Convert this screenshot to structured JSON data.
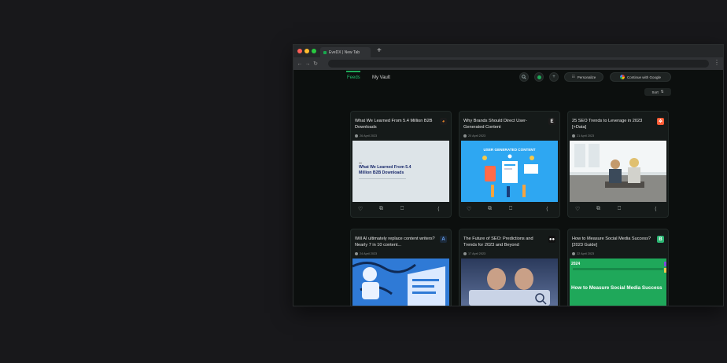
{
  "browser": {
    "tab_title": "EveDX | New Tab",
    "new_tab_glyph": "+",
    "back_glyph": "←",
    "forward_glyph": "→",
    "reload_glyph": "↻",
    "menu_glyph": "⋮"
  },
  "header": {
    "tabs": [
      {
        "label": "Feeds",
        "active": true
      },
      {
        "label": "My Vault",
        "active": false
      }
    ],
    "search_icon": "search-icon",
    "personalize_label": "Personalize",
    "google_label": "Continue with Google",
    "sort_label": "Sort",
    "sort_glyph": "⇅"
  },
  "cards": [
    {
      "title": "What We Learned From 5.4 Million B2B Downloads",
      "date": "26 April 2023",
      "source_glyph": "◕",
      "source_bg": "#1c1c1c",
      "source_fg": "#f28c28"
    },
    {
      "title": "Why Brands Should Direct User-Generated Content",
      "date": "20 April 2023",
      "source_glyph": "E",
      "source_bg": "#1c1c1c",
      "source_fg": "#ffffff"
    },
    {
      "title": "25 SEO Trends to Leverage in 2023 [+Data]",
      "date": "21 April 2023",
      "source_glyph": "✲",
      "source_bg": "#ff5c35",
      "source_fg": "#ffffff"
    },
    {
      "title": "Will AI ultimately replace content writers? Nearly 7 in 10 content...",
      "date": "24 April 2023",
      "source_glyph": "A",
      "source_bg": "#1c2a3a",
      "source_fg": "#6aa7ff"
    },
    {
      "title": "The Future of SEO: Predictions and Trends for 2023 and Beyond",
      "date": "17 April 2023",
      "source_glyph": "●●",
      "source_bg": "#111111",
      "source_fg": "#ffffff"
    },
    {
      "title": "How to Measure Social Media Success? [2023 Guide]",
      "date": "22 April 2023",
      "source_glyph": "B",
      "source_bg": "#2bb673",
      "source_fg": "#ffffff"
    }
  ],
  "thumbs": {
    "t1_title": "What We Learned From 5.4 Million B2B Downloads",
    "t2_banner": "USER GENERATED CONTENT",
    "t6_year": "2024",
    "t6_headline": "How to Measure Social Media Success"
  },
  "icons": {
    "like": "♡",
    "copy": "⧉",
    "save": "⎕",
    "share": "⟨"
  }
}
